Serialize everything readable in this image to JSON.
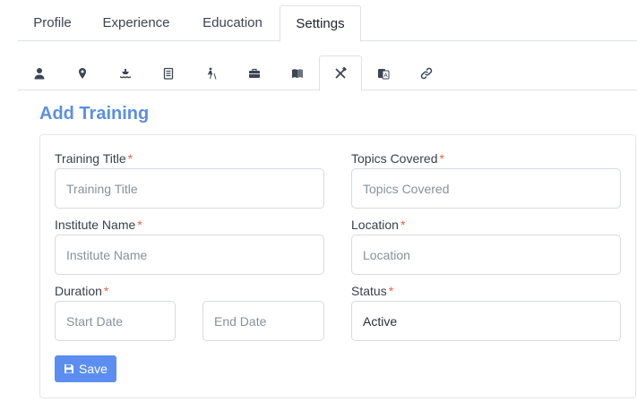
{
  "tabs": {
    "profile": "Profile",
    "experience": "Experience",
    "education": "Education",
    "settings": "Settings"
  },
  "icon_tabs": [
    "user-icon",
    "map-pin-icon",
    "boat-icon",
    "clipboard-icon",
    "walking-cane-icon",
    "briefcase-icon",
    "book-icon",
    "tools-icon",
    "language-icon",
    "link-icon"
  ],
  "section": {
    "title": "Add Training"
  },
  "form": {
    "training_title": {
      "label": "Training Title",
      "required": "*",
      "placeholder": "Training Title"
    },
    "topics_covered": {
      "label": "Topics Covered",
      "required": "*",
      "placeholder": "Topics Covered"
    },
    "institute_name": {
      "label": "Institute Name",
      "required": "*",
      "placeholder": "Institute Name"
    },
    "location": {
      "label": "Location",
      "required": "*",
      "placeholder": "Location"
    },
    "duration": {
      "label": "Duration",
      "required": "*",
      "start_placeholder": "Start Date",
      "end_placeholder": "End Date"
    },
    "status": {
      "label": "Status",
      "required": "*",
      "value": "Active"
    }
  },
  "actions": {
    "save_label": "Save"
  },
  "colors": {
    "accent": "#5b8fe3",
    "button": "#5b8ef0",
    "required": "#e8643d",
    "icon": "#3d4552"
  }
}
